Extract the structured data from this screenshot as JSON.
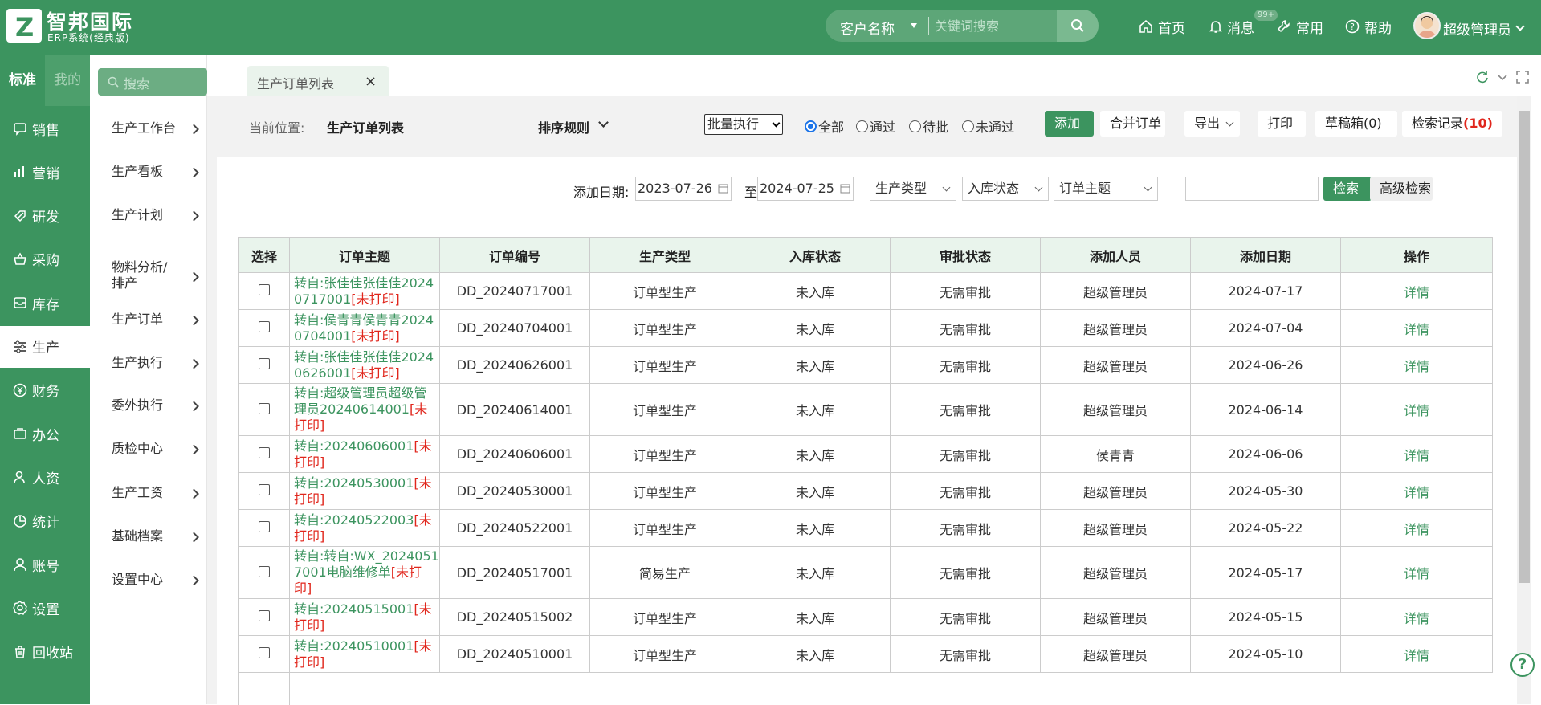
{
  "header": {
    "brand_title": "智邦国际",
    "brand_subtitle": "ERP系统(经典版)",
    "search_category": "客户名称",
    "search_placeholder": "关键词搜索",
    "nav_home": "首页",
    "nav_messages": "消息",
    "nav_messages_badge": "99+",
    "nav_common": "常用",
    "nav_help": "帮助",
    "user_name": "超级管理员"
  },
  "sidebar": {
    "tab_standard": "标准",
    "tab_mine": "我的",
    "items": [
      {
        "label": "销售",
        "icon": "chat-icon"
      },
      {
        "label": "营销",
        "icon": "bar-chart-icon"
      },
      {
        "label": "研发",
        "icon": "rocket-icon"
      },
      {
        "label": "采购",
        "icon": "basket-icon"
      },
      {
        "label": "库存",
        "icon": "inventory-icon"
      },
      {
        "label": "生产",
        "icon": "production-icon"
      },
      {
        "label": "财务",
        "icon": "yen-icon"
      },
      {
        "label": "办公",
        "icon": "briefcase-icon"
      },
      {
        "label": "人资",
        "icon": "people-icon"
      },
      {
        "label": "统计",
        "icon": "pie-chart-icon"
      },
      {
        "label": "账号",
        "icon": "user-icon"
      },
      {
        "label": "设置",
        "icon": "settings-icon"
      },
      {
        "label": "回收站",
        "icon": "trash-icon"
      }
    ],
    "active_item": "生产"
  },
  "subnav": {
    "search_placeholder": "搜索",
    "items": [
      {
        "label": "生产工作台"
      },
      {
        "label": "生产看板"
      },
      {
        "label": "生产计划"
      },
      {
        "label": "物料分析/排产"
      },
      {
        "label": "生产订单"
      },
      {
        "label": "生产执行"
      },
      {
        "label": "委外执行"
      },
      {
        "label": "质检中心"
      },
      {
        "label": "生产工资"
      },
      {
        "label": "基础档案"
      },
      {
        "label": "设置中心"
      }
    ]
  },
  "tabs": {
    "active_tab": "生产订单列表",
    "close": "×"
  },
  "toolbar": {
    "breadcrumb_label": "当前位置:",
    "breadcrumb_value": "生产订单列表",
    "sort_label": "排序规则",
    "batch_select": "批量执行",
    "radio_all": "全部",
    "radio_pass": "通过",
    "radio_pending": "待批",
    "radio_fail": "未通过",
    "selected_radio": "全部",
    "btn_add": "添加",
    "btn_merge": "合并订单",
    "btn_export": "导出",
    "btn_print": "打印",
    "btn_drafts": "草稿箱(0)",
    "btn_search_log": "检索记录",
    "search_log_count": "(10)"
  },
  "filters": {
    "date_label": "添加日期:",
    "date_from": "2023-07-26",
    "to_label": "至",
    "date_to": "2024-07-25",
    "type_select": "生产类型",
    "stock_select": "入库状态",
    "subject_select": "订单主题",
    "keyword_value": "",
    "btn_search": "检索",
    "btn_advanced": "高级检索"
  },
  "table": {
    "columns": [
      "选择",
      "订单主题",
      "订单编号",
      "生产类型",
      "入库状态",
      "审批状态",
      "添加人员",
      "添加日期",
      "操作"
    ],
    "rows": [
      {
        "subject": "转自:张佳佳张佳佳20240717001",
        "print": "[未打印]",
        "code": "DD_20240717001",
        "type": "订单型生产",
        "stock": "未入库",
        "approval": "无需审批",
        "user": "超级管理员",
        "date": "2024-07-17",
        "action": "详情"
      },
      {
        "subject": "转自:侯青青侯青青20240704001",
        "print": "[未打印]",
        "code": "DD_20240704001",
        "type": "订单型生产",
        "stock": "未入库",
        "approval": "无需审批",
        "user": "超级管理员",
        "date": "2024-07-04",
        "action": "详情"
      },
      {
        "subject": "转自:张佳佳张佳佳20240626001",
        "print": "[未打印]",
        "code": "DD_20240626001",
        "type": "订单型生产",
        "stock": "未入库",
        "approval": "无需审批",
        "user": "超级管理员",
        "date": "2024-06-26",
        "action": "详情"
      },
      {
        "subject": "转自:超级管理员超级管理员20240614001",
        "print": "[未打印]",
        "code": "DD_20240614001",
        "type": "订单型生产",
        "stock": "未入库",
        "approval": "无需审批",
        "user": "超级管理员",
        "date": "2024-06-14",
        "action": "详情"
      },
      {
        "subject": "转自:20240606001",
        "print": "[未打印]",
        "code": "DD_20240606001",
        "type": "订单型生产",
        "stock": "未入库",
        "approval": "无需审批",
        "user": "侯青青",
        "date": "2024-06-06",
        "action": "详情"
      },
      {
        "subject": "转自:20240530001",
        "print": "[未打印]",
        "code": "DD_20240530001",
        "type": "订单型生产",
        "stock": "未入库",
        "approval": "无需审批",
        "user": "超级管理员",
        "date": "2024-05-30",
        "action": "详情"
      },
      {
        "subject": "转自:20240522003",
        "print": "[未打印]",
        "code": "DD_20240522001",
        "type": "订单型生产",
        "stock": "未入库",
        "approval": "无需审批",
        "user": "超级管理员",
        "date": "2024-05-22",
        "action": "详情"
      },
      {
        "subject": "转自:转自:WX_20240517001电脑维修单",
        "print": "[未打印]",
        "code": "DD_20240517001",
        "type": "简易生产",
        "stock": "未入库",
        "approval": "无需审批",
        "user": "超级管理员",
        "date": "2024-05-17",
        "action": "详情"
      },
      {
        "subject": "转自:20240515001",
        "print": "[未打印]",
        "code": "DD_20240515002",
        "type": "订单型生产",
        "stock": "未入库",
        "approval": "无需审批",
        "user": "超级管理员",
        "date": "2024-05-15",
        "action": "详情"
      },
      {
        "subject": "转自:20240510001",
        "print": "[未打印]",
        "code": "DD_20240510001",
        "type": "订单型生产",
        "stock": "未入库",
        "approval": "无需审批",
        "user": "超级管理员",
        "date": "2024-05-10",
        "action": "详情"
      }
    ]
  },
  "colors": {
    "brand": "#3c945f",
    "accent_red": "#e0261c",
    "header_row": "#e9f4ec"
  }
}
